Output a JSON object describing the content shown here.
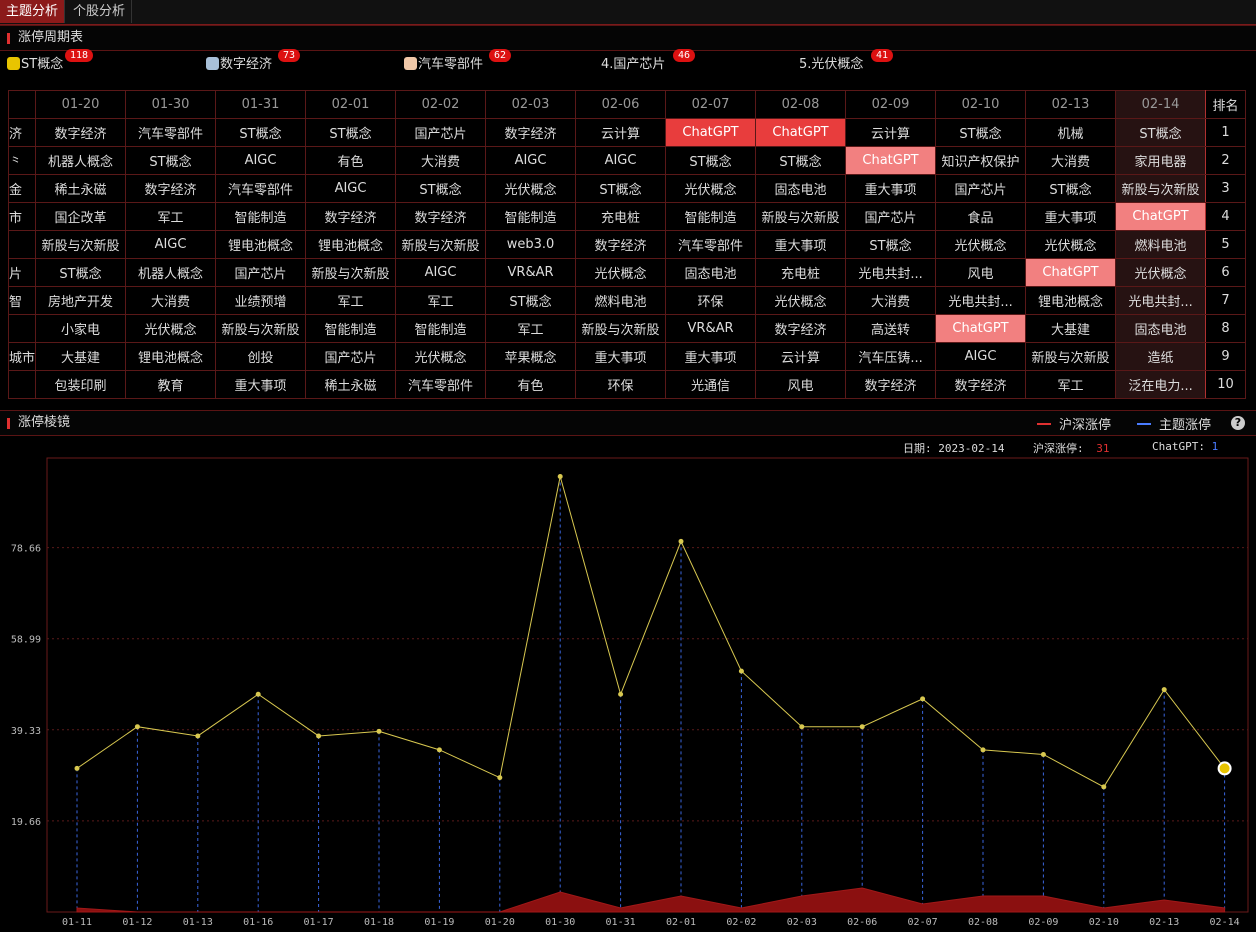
{
  "tabs": [
    {
      "label": "主题分析",
      "active": true
    },
    {
      "label": "个股分析",
      "active": false
    }
  ],
  "cycle_section": {
    "title": "涨停周期表"
  },
  "topics": [
    {
      "name": "ST概念",
      "count": "118",
      "color": "#e8c400"
    },
    {
      "name": "数字经济",
      "count": "73",
      "color": "#a8c0d8"
    },
    {
      "name": "汽车零部件",
      "count": "62",
      "color": "#f0c8a8"
    },
    {
      "name": "4.国产芯片",
      "count": "46"
    },
    {
      "name": "5.光伏概念",
      "count": "41"
    }
  ],
  "table": {
    "dates": [
      "01-20",
      "01-30",
      "01-31",
      "02-01",
      "02-02",
      "02-03",
      "02-06",
      "02-07",
      "02-08",
      "02-09",
      "02-10",
      "02-13",
      "02-14"
    ],
    "rank_header": "排名",
    "cut_column": [
      "济",
      "⺀",
      "⾦",
      "市",
      "",
      "片",
      "智",
      "",
      "城市",
      ""
    ],
    "rows": [
      {
        "rank": "1",
        "cells": [
          "数字经济",
          "汽车零部件",
          "ST概念",
          "ST概念",
          "国产芯片",
          "数字经济",
          "云计算",
          "ChatGPT",
          "ChatGPT",
          "云计算",
          "ST概念",
          "机械",
          "ST概念"
        ]
      },
      {
        "rank": "2",
        "cells": [
          "机器人概念",
          "ST概念",
          "AIGC",
          "有色",
          "大消费",
          "AIGC",
          "AIGC",
          "ST概念",
          "ST概念",
          "ChatGPT",
          "知识产权保护",
          "大消费",
          "家用电器"
        ]
      },
      {
        "rank": "3",
        "cells": [
          "稀土永磁",
          "数字经济",
          "汽车零部件",
          "AIGC",
          "ST概念",
          "光伏概念",
          "ST概念",
          "光伏概念",
          "固态电池",
          "重大事项",
          "国产芯片",
          "ST概念",
          "新股与次新股"
        ]
      },
      {
        "rank": "4",
        "cells": [
          "国企改革",
          "军工",
          "智能制造",
          "数字经济",
          "数字经济",
          "智能制造",
          "充电桩",
          "智能制造",
          "新股与次新股",
          "国产芯片",
          "食品",
          "重大事项",
          "ChatGPT"
        ]
      },
      {
        "rank": "5",
        "cells": [
          "新股与次新股",
          "AIGC",
          "锂电池概念",
          "锂电池概念",
          "新股与次新股",
          "web3.0",
          "数字经济",
          "汽车零部件",
          "重大事项",
          "ST概念",
          "光伏概念",
          "光伏概念",
          "燃料电池"
        ]
      },
      {
        "rank": "6",
        "cells": [
          "ST概念",
          "机器人概念",
          "国产芯片",
          "新股与次新股",
          "AIGC",
          "VR&AR",
          "光伏概念",
          "固态电池",
          "充电桩",
          "光电共封...",
          "风电",
          "ChatGPT",
          "光伏概念"
        ]
      },
      {
        "rank": "7",
        "cells": [
          "房地产开发",
          "大消费",
          "业绩预增",
          "军工",
          "军工",
          "ST概念",
          "燃料电池",
          "环保",
          "光伏概念",
          "大消费",
          "光电共封...",
          "锂电池概念",
          "光电共封..."
        ]
      },
      {
        "rank": "8",
        "cells": [
          "小家电",
          "光伏概念",
          "新股与次新股",
          "智能制造",
          "智能制造",
          "军工",
          "新股与次新股",
          "VR&AR",
          "数字经济",
          "高送转",
          "ChatGPT",
          "大基建",
          "固态电池"
        ]
      },
      {
        "rank": "9",
        "cells": [
          "大基建",
          "锂电池概念",
          "创投",
          "国产芯片",
          "光伏概念",
          "苹果概念",
          "重大事项",
          "重大事项",
          "云计算",
          "汽车压铸...",
          "AIGC",
          "新股与次新股",
          "造纸"
        ]
      },
      {
        "rank": "10",
        "cells": [
          "包装印刷",
          "教育",
          "重大事项",
          "稀土永磁",
          "汽车零部件",
          "有色",
          "环保",
          "光通信",
          "风电",
          "数字经济",
          "数字经济",
          "军工",
          "泛在电力..."
        ]
      }
    ]
  },
  "prism_section": {
    "title": "涨停棱镜",
    "legend": [
      {
        "label": "沪深涨停",
        "color": "#e03030"
      },
      {
        "label": "主题涨停",
        "color": "#4a7cff"
      }
    ],
    "help_label": "?",
    "info": {
      "date_label": "日期:",
      "date_value": "2023-02-14",
      "market_label": "沪深涨停:",
      "market_value": "31",
      "topic_label": "ChatGPT:",
      "topic_value": "1"
    }
  },
  "chart_data": {
    "type": "line",
    "x": [
      "01-11",
      "01-12",
      "01-13",
      "01-16",
      "01-17",
      "01-18",
      "01-19",
      "01-20",
      "01-30",
      "01-31",
      "02-01",
      "02-02",
      "02-03",
      "02-06",
      "02-07",
      "02-08",
      "02-09",
      "02-10",
      "02-13",
      "02-14"
    ],
    "series": [
      {
        "name": "沪深涨停",
        "values": [
          31,
          40,
          38,
          47,
          38,
          39,
          35,
          29,
          94,
          47,
          80,
          52,
          40,
          40,
          46,
          35,
          34,
          27,
          48,
          31
        ]
      },
      {
        "name": "主题涨停",
        "values": [
          1,
          0,
          0,
          0,
          0,
          0,
          0,
          0,
          5,
          1,
          4,
          1,
          4,
          6,
          2,
          4,
          4,
          1,
          3,
          1
        ]
      }
    ],
    "yticks": [
      "78.66",
      "58.99",
      "39.33",
      "19.66"
    ],
    "ylim": [
      0,
      98
    ]
  }
}
